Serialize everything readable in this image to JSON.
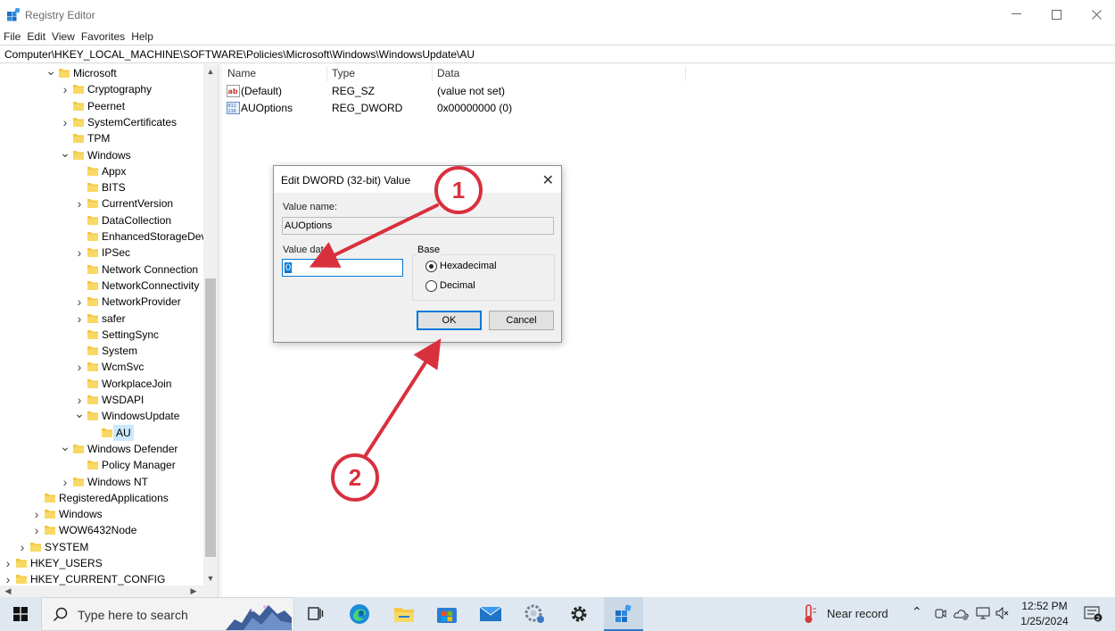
{
  "window": {
    "title": "Registry Editor",
    "minimize_icon": "minimize-icon",
    "maximize_icon": "maximize-icon",
    "close_icon": "close-icon"
  },
  "menu": [
    "File",
    "Edit",
    "View",
    "Favorites",
    "Help"
  ],
  "address": "Computer\\HKEY_LOCAL_MACHINE\\SOFTWARE\\Policies\\Microsoft\\Windows\\WindowsUpdate\\AU",
  "tree": [
    {
      "label": "Microsoft",
      "state": "expanded"
    },
    {
      "label": "Cryptography",
      "state": "collapsed"
    },
    {
      "label": "Peernet",
      "state": "leaf"
    },
    {
      "label": "SystemCertificates",
      "state": "collapsed"
    },
    {
      "label": "TPM",
      "state": "leaf"
    },
    {
      "label": "Windows",
      "state": "expanded"
    },
    {
      "label": "Appx",
      "state": "leaf"
    },
    {
      "label": "BITS",
      "state": "leaf"
    },
    {
      "label": "CurrentVersion",
      "state": "collapsed"
    },
    {
      "label": "DataCollection",
      "state": "leaf"
    },
    {
      "label": "EnhancedStorageDev",
      "state": "leaf"
    },
    {
      "label": "IPSec",
      "state": "collapsed"
    },
    {
      "label": "Network Connection",
      "state": "leaf"
    },
    {
      "label": "NetworkConnectivity",
      "state": "leaf"
    },
    {
      "label": "NetworkProvider",
      "state": "collapsed"
    },
    {
      "label": "safer",
      "state": "collapsed"
    },
    {
      "label": "SettingSync",
      "state": "leaf"
    },
    {
      "label": "System",
      "state": "leaf"
    },
    {
      "label": "WcmSvc",
      "state": "collapsed"
    },
    {
      "label": "WorkplaceJoin",
      "state": "leaf"
    },
    {
      "label": "WSDAPI",
      "state": "collapsed"
    },
    {
      "label": "WindowsUpdate",
      "state": "expanded"
    },
    {
      "label": "AU",
      "state": "selected"
    },
    {
      "label": "Windows Defender",
      "state": "expanded"
    },
    {
      "label": "Policy Manager",
      "state": "leaf"
    },
    {
      "label": "Windows NT",
      "state": "collapsed"
    },
    {
      "label": "RegisteredApplications",
      "state": "leaf"
    },
    {
      "label": "Windows",
      "state": "collapsed"
    },
    {
      "label": "WOW6432Node",
      "state": "collapsed"
    },
    {
      "label": "SYSTEM",
      "state": "collapsed"
    },
    {
      "label": "HKEY_USERS",
      "state": "collapsed"
    },
    {
      "label": "HKEY_CURRENT_CONFIG",
      "state": "collapsed"
    }
  ],
  "list": {
    "columns": [
      "Name",
      "Type",
      "Data"
    ],
    "rows": [
      {
        "icon": "string-value-icon",
        "name": "(Default)",
        "type": "REG_SZ",
        "data": "(value not set)"
      },
      {
        "icon": "binary-value-icon",
        "name": "AUOptions",
        "type": "REG_DWORD",
        "data": "0x00000000 (0)"
      }
    ]
  },
  "dialog": {
    "title": "Edit DWORD (32-bit) Value",
    "value_name_label": "Value name:",
    "value_name": "AUOptions",
    "value_data_label": "Value data:",
    "value_data": "0",
    "base_label": "Base",
    "hex_label": "Hexadecimal",
    "dec_label": "Decimal",
    "selected_base": "Hexadecimal",
    "ok_label": "OK",
    "cancel_label": "Cancel"
  },
  "annotations": {
    "step1": "1",
    "step2": "2",
    "color": "#d9303e"
  },
  "taskbar": {
    "search_placeholder": "Type here to search",
    "apps": [
      "task-view-icon",
      "edge-icon",
      "file-explorer-icon",
      "store-icon",
      "mail-icon",
      "network-settings-icon",
      "settings-icon",
      "registry-editor-icon"
    ],
    "weather": "Near record",
    "time": "12:52 PM",
    "date": "1/25/2024"
  },
  "colors": {
    "accent": "#0078d7",
    "selection": "#cce8ff",
    "taskbar": "#dfe8f1",
    "folder": "#f3c843"
  }
}
